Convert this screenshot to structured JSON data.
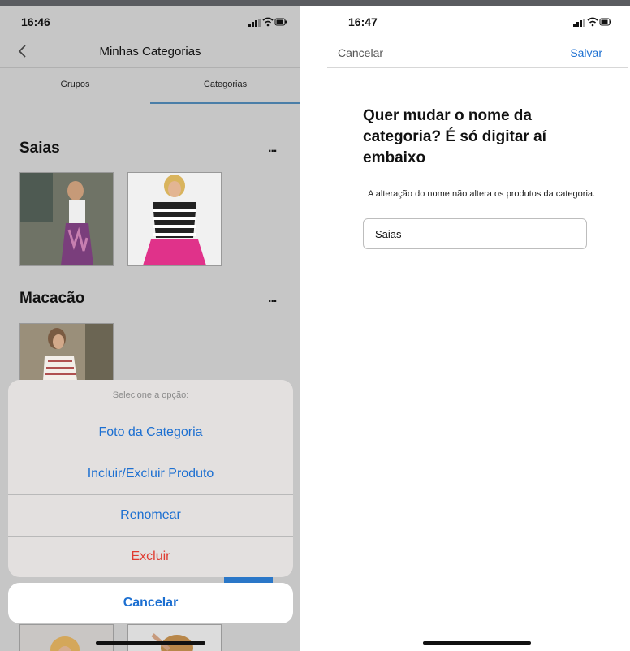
{
  "left": {
    "status": {
      "time": "16:46"
    },
    "nav": {
      "title": "Minhas Categorias"
    },
    "tabs": [
      {
        "label": "Grupos"
      },
      {
        "label": "Categorias"
      }
    ],
    "categories": [
      {
        "name": "Saias",
        "more": "..."
      },
      {
        "name": "Macacão",
        "more": "..."
      }
    ],
    "sheet": {
      "title": "Selecione a opção:",
      "options": [
        "Foto da Categoria",
        "Incluir/Excluir Produto",
        "Renomear",
        "Excluir"
      ],
      "cancel": "Cancelar"
    }
  },
  "right": {
    "status": {
      "time": "16:47"
    },
    "nav": {
      "cancel": "Cancelar",
      "save": "Salvar"
    },
    "heading": "Quer mudar o nome da categoria? É só digitar aí embaixo",
    "help": "A alteração do nome não altera os produtos da categoria.",
    "input_value": "Saias"
  },
  "colors": {
    "accent": "#1c6fd1",
    "destructive": "#e03b30",
    "tab_indicator": "#4a7ea8"
  },
  "icons": [
    "signal-icon",
    "wifi-icon",
    "battery-icon",
    "chevron-left-icon"
  ]
}
